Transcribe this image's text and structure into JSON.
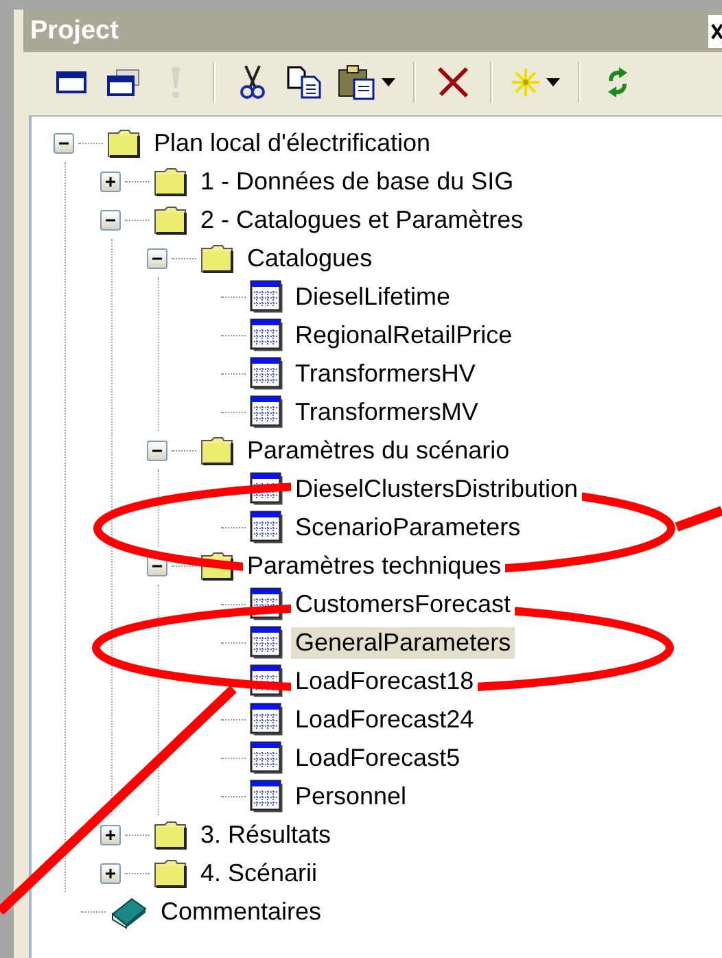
{
  "panel": {
    "title": "Project"
  },
  "toolbar": [
    {
      "kind": "window",
      "disabled": false
    },
    {
      "kind": "windows",
      "disabled": false
    },
    {
      "kind": "alert",
      "disabled": true
    },
    {
      "kind": "separator"
    },
    {
      "kind": "cut",
      "disabled": false
    },
    {
      "kind": "copy",
      "disabled": false
    },
    {
      "kind": "paste",
      "disabled": false,
      "dropdown": true
    },
    {
      "kind": "separator"
    },
    {
      "kind": "delete",
      "disabled": false
    },
    {
      "kind": "separator"
    },
    {
      "kind": "new",
      "disabled": false,
      "dropdown": true
    },
    {
      "kind": "separator"
    },
    {
      "kind": "refresh",
      "disabled": false
    }
  ],
  "tree": [
    {
      "label": "Plan local d'électrification",
      "kind": "folder",
      "expanded": true,
      "selected": false,
      "children": [
        {
          "label": "1 - Données de base du SIG",
          "kind": "folder",
          "expanded": false,
          "selected": false
        },
        {
          "label": "2 - Catalogues et Paramètres",
          "kind": "folder",
          "expanded": true,
          "selected": false,
          "children": [
            {
              "label": "Catalogues",
              "kind": "folder",
              "expanded": true,
              "selected": false,
              "children": [
                {
                  "label": "DieselLifetime",
                  "kind": "table",
                  "selected": false
                },
                {
                  "label": "RegionalRetailPrice",
                  "kind": "table",
                  "selected": false
                },
                {
                  "label": "TransformersHV",
                  "kind": "table",
                  "selected": false
                },
                {
                  "label": "TransformersMV",
                  "kind": "table",
                  "selected": false
                }
              ]
            },
            {
              "label": "Paramètres du scénario",
              "kind": "folder",
              "expanded": true,
              "selected": false,
              "children": [
                {
                  "label": "DieselClustersDistribution",
                  "kind": "table",
                  "selected": false
                },
                {
                  "label": "ScenarioParameters",
                  "kind": "table",
                  "selected": false
                }
              ]
            },
            {
              "label": "Paramètres techniques",
              "kind": "folder",
              "expanded": true,
              "selected": false,
              "children": [
                {
                  "label": "CustomersForecast",
                  "kind": "table",
                  "selected": false
                },
                {
                  "label": "GeneralParameters",
                  "kind": "table",
                  "selected": true
                },
                {
                  "label": "LoadForecast18",
                  "kind": "table",
                  "selected": false
                },
                {
                  "label": "LoadForecast24",
                  "kind": "table",
                  "selected": false
                },
                {
                  "label": "LoadForecast5",
                  "kind": "table",
                  "selected": false
                },
                {
                  "label": "Personnel",
                  "kind": "table",
                  "selected": false
                }
              ]
            }
          ]
        },
        {
          "label": "3. Résultats",
          "kind": "folder",
          "expanded": false,
          "selected": false
        },
        {
          "label": "4. Scénarii",
          "kind": "folder",
          "expanded": false,
          "selected": false
        }
      ]
    },
    {
      "label": "Commentaires",
      "kind": "book",
      "selected": false
    }
  ]
}
